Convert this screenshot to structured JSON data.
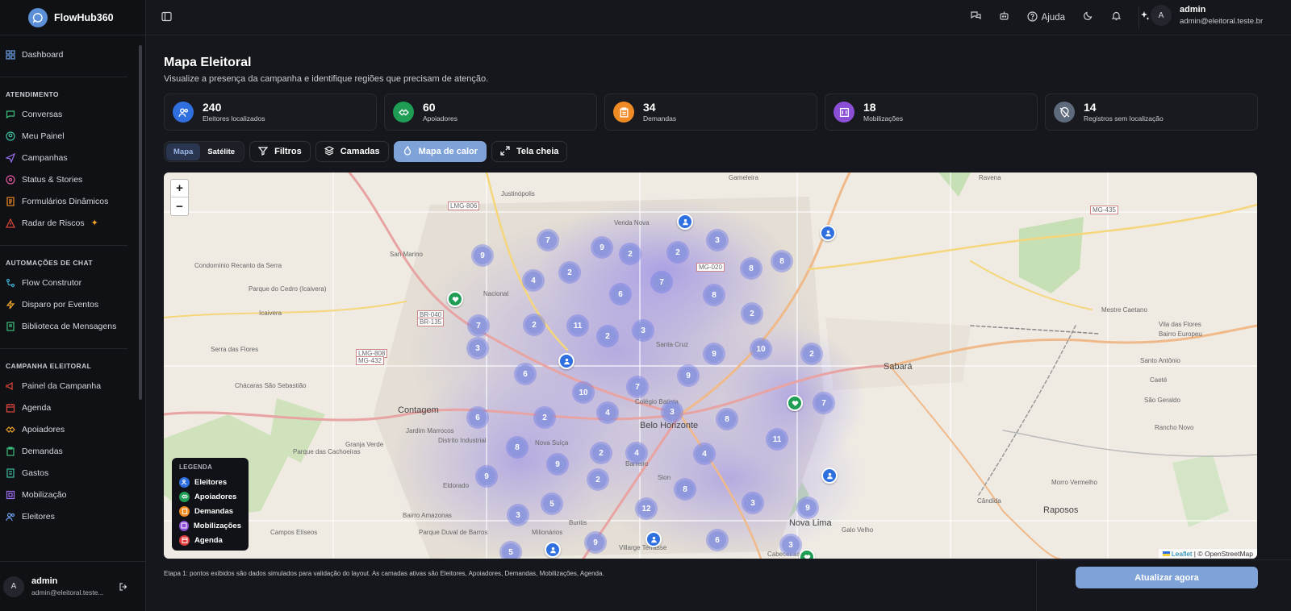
{
  "app": {
    "name": "FlowHub360"
  },
  "sidebar": {
    "dashboard": "Dashboard",
    "sections": [
      {
        "title": "ATENDIMENTO",
        "items": [
          "Conversas",
          "Meu Painel",
          "Campanhas",
          "Status & Stories",
          "Formulários Dinâmicos",
          "Radar de Riscos"
        ]
      },
      {
        "title": "AUTOMAÇÕES DE CHAT",
        "items": [
          "Flow Construtor",
          "Disparo por Eventos",
          "Biblioteca de Mensagens"
        ]
      },
      {
        "title": "CAMPANHA ELEITORAL",
        "items": [
          "Painel da Campanha",
          "Agenda",
          "Apoiadores",
          "Demandas",
          "Gastos",
          "Mobilização",
          "Eleitores"
        ]
      }
    ],
    "user": {
      "initial": "A",
      "name": "admin",
      "email": "admin@eleitoral.teste..."
    }
  },
  "topbar": {
    "help_label": "Ajuda",
    "user": {
      "initial": "A",
      "name": "admin",
      "email": "admin@eleitoral.teste.br"
    }
  },
  "page": {
    "title": "Mapa Eleitoral",
    "subtitle": "Visualize a presença da campanha e identifique regiões que precisam de atenção."
  },
  "stats": [
    {
      "value": "240",
      "label": "Eleitores localizados",
      "color": "#2f6fe0",
      "icon": "users-icon"
    },
    {
      "value": "60",
      "label": "Apoiadores",
      "color": "#1f9d55",
      "icon": "handshake-icon"
    },
    {
      "value": "34",
      "label": "Demandas",
      "color": "#f08a24",
      "icon": "clipboard-icon"
    },
    {
      "value": "18",
      "label": "Mobilizações",
      "color": "#8b4fd6",
      "icon": "calendar-icon"
    },
    {
      "value": "14",
      "label": "Registros sem localização",
      "color": "#5e6b7c",
      "icon": "pin-off-icon"
    }
  ],
  "toolbar": {
    "map_label": "Mapa",
    "satellite_label": "Satélite",
    "filters_label": "Filtros",
    "layers_label": "Camadas",
    "heatmap_label": "Mapa de calor",
    "fullscreen_label": "Tela cheia"
  },
  "map": {
    "zoom_in": "+",
    "zoom_out": "−",
    "places": [
      "Gameleira",
      "Ravena",
      "Justinópolis",
      "Venda Nova",
      "LMG-806",
      "MG-435",
      "San Marino",
      "Condomínio Recanto da Serra",
      "Parque do Cedro (Icaivera)",
      "Icaivera",
      "Nacional",
      "BR-040",
      "BR-135",
      "MG-020",
      "Mestre Caetano",
      "Vila das Flores",
      "Bairro Europeu",
      "Serra das Flores",
      "LMG-808",
      "MG-432",
      "Santa Cruz",
      "Sabará",
      "Santo Antônio",
      "Caeté",
      "Chácaras São Sebastião",
      "Contagem",
      "Colégio Batista",
      "Belo Horizonte",
      "São Geraldo",
      "Rancho Novo",
      "Jardim Marrocos",
      "Nova Suíça",
      "Parque das Cachoeiras",
      "Granja Verde",
      "Distrito Industrial",
      "Eldorado",
      "Milionários",
      "Buritis",
      "Barreiro",
      "Sion",
      "Morro Vermelho",
      "Raposos",
      "Cândida",
      "Nova Lima",
      "Galo Velho",
      "Cabeceiras",
      "Bairro Amazonas",
      "Parque Duval de Barros",
      "Campos Elíseos",
      "Villarge Terrasse"
    ],
    "clusters": [
      9,
      7,
      9,
      2,
      2,
      3,
      8,
      8,
      4,
      2,
      6,
      7,
      8,
      7,
      2,
      11,
      2,
      3,
      2,
      10,
      3,
      6,
      9,
      2,
      7,
      10,
      9,
      6,
      2,
      4,
      3,
      8,
      7,
      11,
      8,
      9,
      2,
      4,
      9,
      2,
      4,
      3,
      5,
      12,
      8,
      3,
      9,
      6,
      5,
      9,
      3
    ],
    "legend": {
      "title": "LEGENDA",
      "items": [
        {
          "label": "Eleitores",
          "color": "#2f6fe0"
        },
        {
          "label": "Apoiadores",
          "color": "#1f9d55"
        },
        {
          "label": "Demandas",
          "color": "#f08a24"
        },
        {
          "label": "Mobilizações",
          "color": "#8b4fd6"
        },
        {
          "label": "Agenda",
          "color": "#e03b3b"
        }
      ]
    },
    "attribution_leaflet": "Leaflet",
    "attribution_osm": "| © OpenStreetMap"
  },
  "footer": {
    "note": "Etapa 1: pontos exibidos são dados simulados para validação do layout. As camadas ativas são Eleitores, Apoiadores, Demandas, Mobilizações, Agenda.",
    "refresh_label": "Atualizar agora"
  }
}
